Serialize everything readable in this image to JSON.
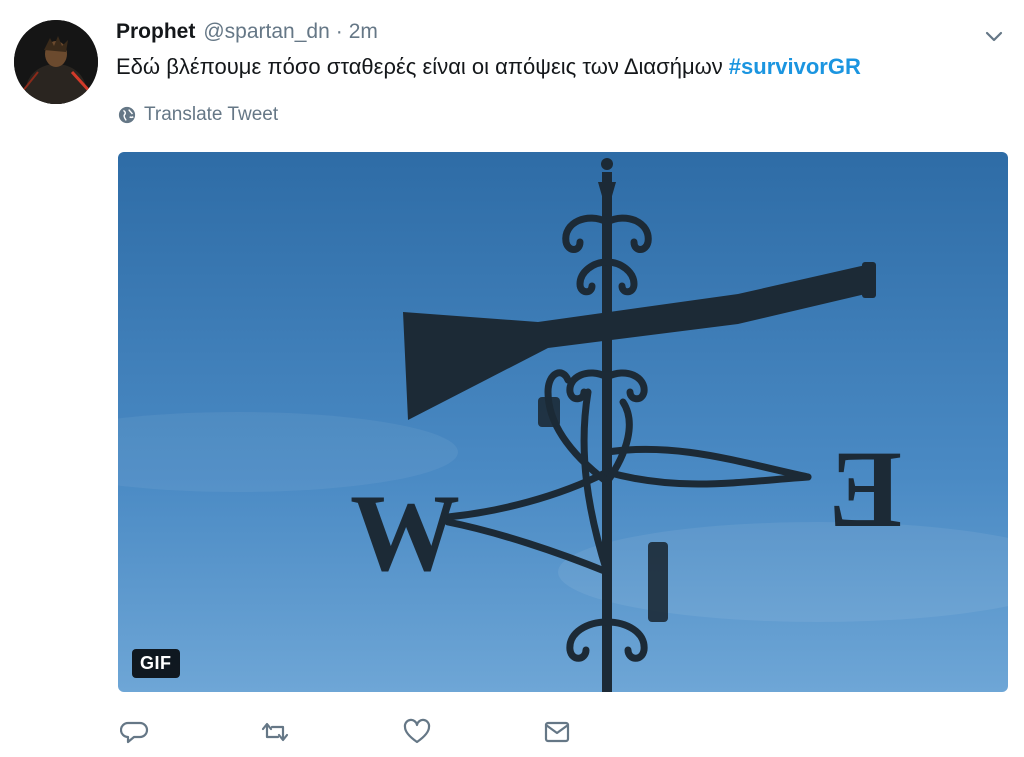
{
  "user": {
    "name": "Prophet",
    "handle": "@spartan_dn",
    "separator": "·",
    "time": "2m"
  },
  "tweet": {
    "text": "Εδώ βλέπουμε πόσο σταθερές είναι οι απόψεις των Διασήμων",
    "hashtag": "#survivorGR"
  },
  "translate": {
    "label": "Translate Tweet"
  },
  "media": {
    "badge": "GIF",
    "letters": {
      "west": "W",
      "east": "E"
    }
  },
  "icons": {
    "reply": "reply-icon",
    "retweet": "retweet-icon",
    "like": "heart-icon",
    "message": "envelope-icon",
    "globe": "globe-icon",
    "caret": "chevron-down-icon"
  },
  "colors": {
    "link": "#1b95e0",
    "muted": "#657786",
    "sky_top": "#2f6ea8",
    "sky_bottom": "#6aa3d4"
  }
}
